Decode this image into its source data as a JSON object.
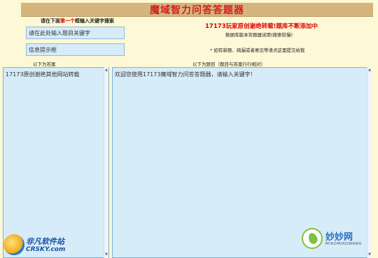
{
  "title": "魔域智力问答答题器",
  "hint": {
    "prefix": "请在下面",
    "highlight": "第一个",
    "suffix": "框输入关键字搜索"
  },
  "keyword_input": {
    "value": "请在此处输入题目关键字"
  },
  "info_input": {
    "value": "信息提示框"
  },
  "promo_text": "17173玩家原创谢绝转载!题库不断添加中",
  "sub_text": "数据库版本答题器试用(搜索较慢)",
  "note": {
    "star": "*",
    "text": "如有新题、疏漏或者意见等请点这里提交给我"
  },
  "answers_label": "以下为答案",
  "questions_label": "以下为题目（题目与答案行行相对）",
  "answers_panel": {
    "text": "17173原创谢绝其他网站转载"
  },
  "questions_panel": {
    "text": "欢迎您使用17173魔域智力问答答题器，请输入关键字！"
  },
  "watermark_left": {
    "line1": "非凡软件站",
    "line2": "CRSKY.com"
  },
  "watermark_right": {
    "line1": "妙妙网",
    "line2": "MIAOMIAOWANG"
  },
  "colors": {
    "title_bg": "#d5b57e",
    "title_text": "#d42020",
    "panel_bg": "#d6ecf8",
    "page_bg": "#fdf8d6"
  }
}
